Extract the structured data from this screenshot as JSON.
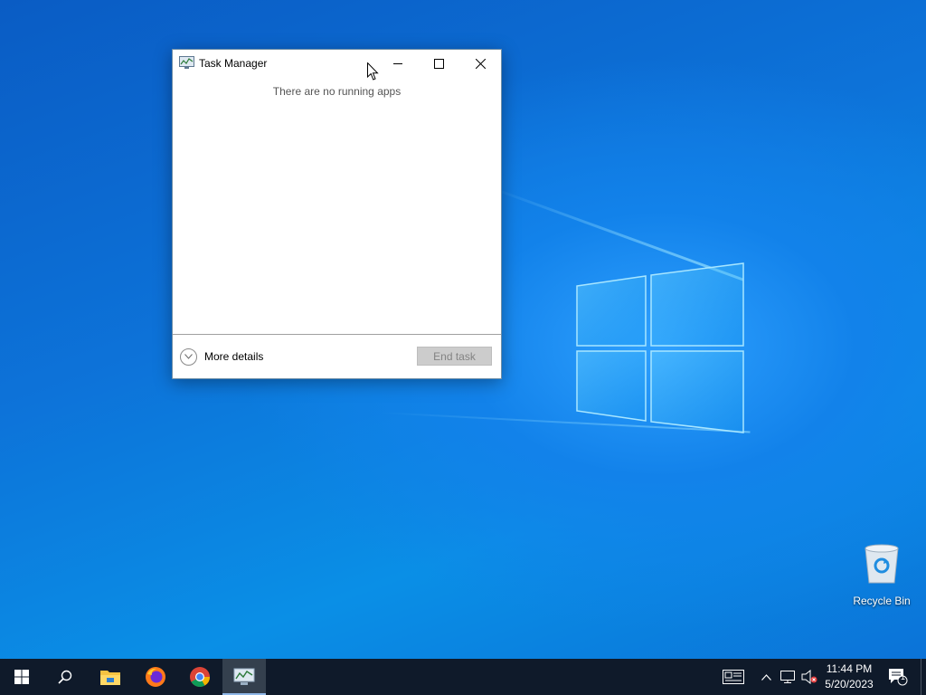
{
  "window": {
    "title": "Task Manager",
    "empty_message": "There are no running apps",
    "more_details_label": "More details",
    "end_task_label": "End task"
  },
  "desktop": {
    "icons": [
      {
        "label": "Recycle Bin",
        "icon": "recycle-bin-icon"
      }
    ]
  },
  "taskbar": {
    "items": [
      "start-icon",
      "search-icon",
      "file-explorer-icon",
      "firefox-icon",
      "chrome-icon",
      "task-manager-icon"
    ],
    "active_item": "task-manager-icon",
    "clock": {
      "time": "11:44 PM",
      "date": "5/20/2023"
    },
    "notification_count": "1"
  },
  "colors": {
    "desktop_blue": "#0d73d9",
    "taskbar": "#0f1a2a"
  }
}
